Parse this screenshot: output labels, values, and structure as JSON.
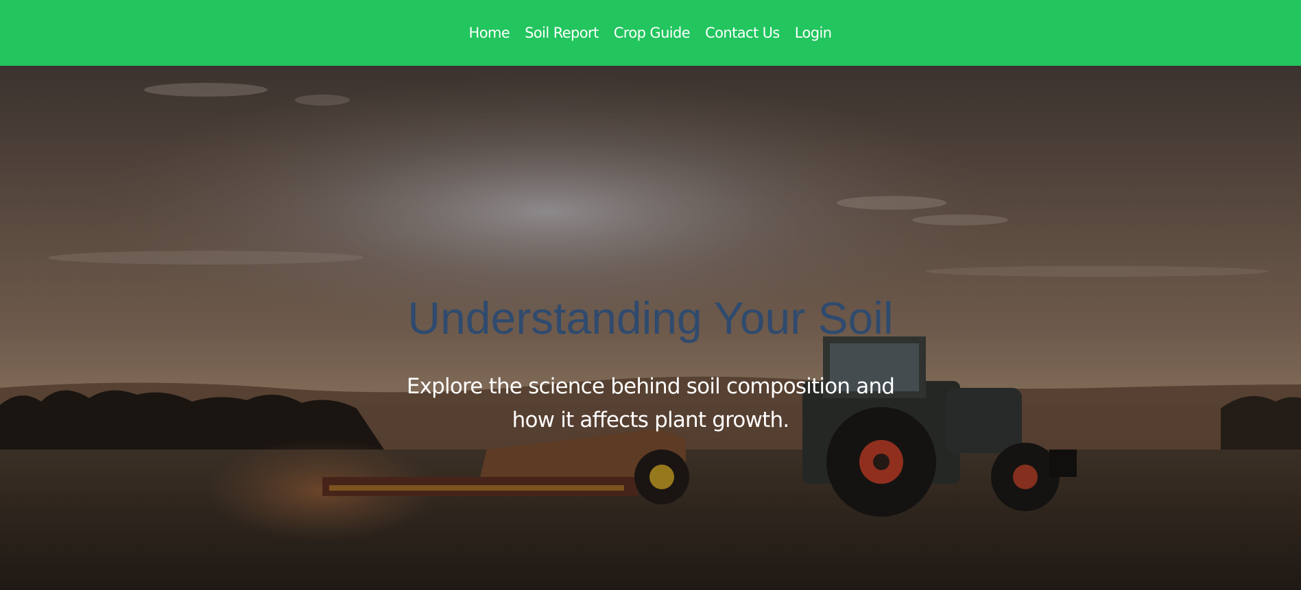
{
  "nav": {
    "items": [
      {
        "label": "Home"
      },
      {
        "label": "Soil Report"
      },
      {
        "label": "Crop Guide"
      },
      {
        "label": "Contact Us"
      },
      {
        "label": "Login"
      }
    ]
  },
  "hero": {
    "title": "Understanding Your Soil",
    "subtitle": "Explore the science behind soil composition and how it affects plant growth.",
    "background_image": "tractor-field-sunset-photo"
  },
  "colors": {
    "navbar_bg": "#22c55e",
    "nav_text": "#ffffff",
    "title_color": "#2f4a6e",
    "subtitle_color": "#ffffff"
  }
}
